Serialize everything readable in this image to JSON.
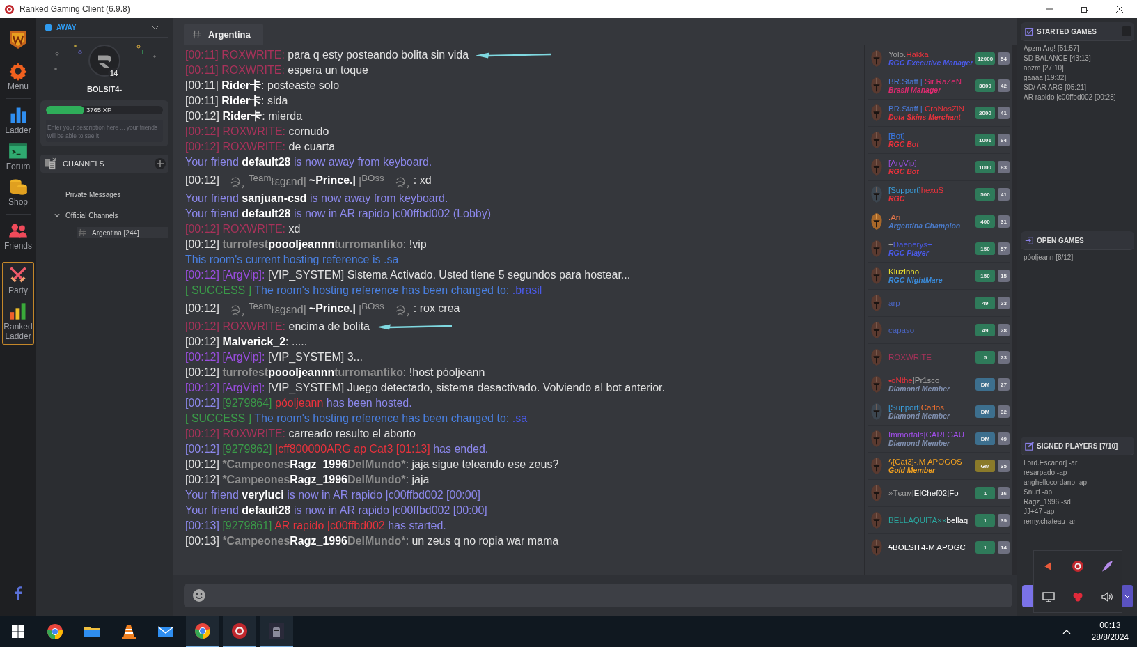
{
  "window": {
    "title": "Ranked Gaming Client (6.9.8)"
  },
  "nav": [
    {
      "label": "Menu",
      "selected": false
    },
    {
      "label": "Ladder",
      "selected": false
    },
    {
      "label": "Forum",
      "selected": false
    },
    {
      "label": "Shop",
      "selected": false
    },
    {
      "label": "Friends",
      "selected": false
    },
    {
      "label": "Party",
      "selected": true
    },
    {
      "label": "Ranked Ladder",
      "selected": true
    }
  ],
  "profile": {
    "status": "AWAY",
    "username": "BOLSIT4-",
    "level_badge": "14",
    "xp": "3765 XP",
    "level": 0.33,
    "description_placeholder": "Enter your description here ... your friends will be able to see it"
  },
  "channels": {
    "title": "CHANNELS",
    "items": [
      {
        "label": "Private Messages",
        "expanded": false
      },
      {
        "label": "Official Channels",
        "expanded": true,
        "children": [
          {
            "label": "Argentina [244]",
            "selected": true
          }
        ]
      }
    ]
  },
  "chat": {
    "tab": "Argentina",
    "lines": [
      {
        "marked": true,
        "segments": [
          {
            "kind": "plain",
            "text": "[00:11] ROXWRITE:",
            "color": "#a8325a"
          },
          {
            "kind": "plain",
            "text": " para q esty posteando bolita sin vida",
            "color": "#e2e2e2"
          }
        ]
      },
      {
        "marked": false,
        "segments": [
          {
            "kind": "plain",
            "text": "[00:11] ROXWRITE:",
            "color": "#a8325a"
          },
          {
            "kind": "plain",
            "text": " espera un toque",
            "color": "#e2e2e2"
          }
        ]
      },
      {
        "marked": false,
        "segments": [
          {
            "kind": "plain",
            "text": "[00:11] ",
            "color": "#e2e2e2"
          },
          {
            "kind": "bold",
            "text": "Rider卡",
            "color": "#ffffff"
          },
          {
            "kind": "plain",
            "text": ": posteaste solo",
            "color": "#e2e2e2"
          }
        ]
      },
      {
        "marked": false,
        "segments": [
          {
            "kind": "plain",
            "text": "[00:11] ",
            "color": "#e2e2e2"
          },
          {
            "kind": "bold",
            "text": "Rider卡",
            "color": "#ffffff"
          },
          {
            "kind": "plain",
            "text": ": sida",
            "color": "#e2e2e2"
          }
        ]
      },
      {
        "marked": false,
        "segments": [
          {
            "kind": "plain",
            "text": "[00:12] ",
            "color": "#e2e2e2"
          },
          {
            "kind": "bold",
            "text": "Rider卡",
            "color": "#ffffff"
          },
          {
            "kind": "plain",
            "text": ": mierda",
            "color": "#e2e2e2"
          }
        ]
      },
      {
        "marked": false,
        "segments": [
          {
            "kind": "plain",
            "text": "[00:12] ROXWRITE:",
            "color": "#a8325a"
          },
          {
            "kind": "plain",
            "text": " cornudo",
            "color": "#e2e2e2"
          }
        ]
      },
      {
        "marked": false,
        "segments": [
          {
            "kind": "plain",
            "text": "[00:12] ROXWRITE:",
            "color": "#a8325a"
          },
          {
            "kind": "plain",
            "text": " de cuarta",
            "color": "#e2e2e2"
          }
        ]
      },
      {
        "marked": false,
        "segments": [
          {
            "kind": "plain",
            "text": "Your friend ",
            "color": "#8c88ec"
          },
          {
            "kind": "bold",
            "text": "default28",
            "color": "#ffffff"
          },
          {
            "kind": "plain",
            "text": " is now away from keyboard.",
            "color": "#8c88ec"
          }
        ]
      },
      {
        "marked": false,
        "segments": [
          {
            "kind": "plain",
            "text": "[00:12]",
            "color": "#e2e2e2"
          },
          {
            "kind": "flourish"
          },
          {
            "kind": "plain",
            "text": "$^{Team}$ℓεgεnd|",
            "color": "#9a9a9a"
          },
          {
            "kind": "bold",
            "text": "~Prince.|",
            "color": "#ffffff"
          },
          {
            "kind": "plain",
            "text": "|$^{BOss}$",
            "color": "#9a9a9a"
          },
          {
            "kind": "flourish"
          },
          {
            "kind": "plain",
            "text": ": xd",
            "color": "#e2e2e2"
          }
        ]
      },
      {
        "marked": false,
        "segments": [
          {
            "kind": "plain",
            "text": "Your friend ",
            "color": "#8c88ec"
          },
          {
            "kind": "bold",
            "text": "sanjuan-csd",
            "color": "#ffffff"
          },
          {
            "kind": "plain",
            "text": " is now away from keyboard.",
            "color": "#8c88ec"
          }
        ]
      },
      {
        "marked": false,
        "segments": [
          {
            "kind": "plain",
            "text": "Your friend ",
            "color": "#8c88ec"
          },
          {
            "kind": "bold",
            "text": "default28",
            "color": "#ffffff"
          },
          {
            "kind": "plain",
            "text": " is now in AR rapido |c00ffbd002 (Lobby)",
            "color": "#8c88ec"
          }
        ]
      },
      {
        "marked": false,
        "segments": [
          {
            "kind": "plain",
            "text": "[00:12] ROXWRITE:",
            "color": "#a8325a"
          },
          {
            "kind": "plain",
            "text": " xd",
            "color": "#e2e2e2"
          }
        ]
      },
      {
        "marked": false,
        "segments": [
          {
            "kind": "plain",
            "text": "[00:12] ",
            "color": "#e2e2e2"
          },
          {
            "kind": "bold",
            "text": "turrofest",
            "color": "#8e8e8e"
          },
          {
            "kind": "bold",
            "text": "poooljeannn",
            "color": "#ffffff"
          },
          {
            "kind": "bold",
            "text": "turromantiko",
            "color": "#8e8e8e"
          },
          {
            "kind": "plain",
            "text": ": !vip",
            "color": "#e2e2e2"
          }
        ]
      },
      {
        "marked": false,
        "segments": [
          {
            "kind": "plain",
            "text": "This room's current hosting reference is .sa",
            "color": "#4a80e2"
          }
        ]
      },
      {
        "marked": false,
        "segments": [
          {
            "kind": "plain",
            "text": "[00:12] [ArgVip]:",
            "color": "#9a4ee0"
          },
          {
            "kind": "plain",
            "text": " [VIP_SYSTEM] Sistema Activado. Usted tiene 5 segundos para hostear...",
            "color": "#e2e2e2"
          }
        ]
      },
      {
        "marked": false,
        "segments": [
          {
            "kind": "plain",
            "text": "[ SUCCESS ]",
            "color": "#3a9a48"
          },
          {
            "kind": "plain",
            "text": " The room's hosting reference has been changed to: ",
            "color": "#4a80e2"
          },
          {
            "kind": "plain",
            "text": ".brasil",
            "color": "#4a5ae8"
          }
        ]
      },
      {
        "marked": false,
        "segments": [
          {
            "kind": "plain",
            "text": "[00:12]",
            "color": "#e2e2e2"
          },
          {
            "kind": "flourish"
          },
          {
            "kind": "plain",
            "text": "$^{Team}$ℓεgεnd|",
            "color": "#9a9a9a"
          },
          {
            "kind": "bold",
            "text": "~Prince.|",
            "color": "#ffffff"
          },
          {
            "kind": "plain",
            "text": "|$^{BOss}$",
            "color": "#9a9a9a"
          },
          {
            "kind": "flourish"
          },
          {
            "kind": "plain",
            "text": ": rox crea",
            "color": "#e2e2e2"
          }
        ]
      },
      {
        "marked": true,
        "segments": [
          {
            "kind": "plain",
            "text": "[00:12] ROXWRITE:",
            "color": "#a8325a"
          },
          {
            "kind": "plain",
            "text": " encima de bolita",
            "color": "#e2e2e2"
          }
        ]
      },
      {
        "marked": false,
        "segments": [
          {
            "kind": "plain",
            "text": "[00:12] ",
            "color": "#e2e2e2"
          },
          {
            "kind": "bold",
            "text": "Malverick_2",
            "color": "#ffffff"
          },
          {
            "kind": "plain",
            "text": ": .....",
            "color": "#e2e2e2"
          }
        ]
      },
      {
        "marked": false,
        "segments": [
          {
            "kind": "plain",
            "text": "[00:12] [ArgVip]:",
            "color": "#9a4ee0"
          },
          {
            "kind": "plain",
            "text": " [VIP_SYSTEM] 3...",
            "color": "#e2e2e2"
          }
        ]
      },
      {
        "marked": false,
        "segments": [
          {
            "kind": "plain",
            "text": "[00:12] ",
            "color": "#e2e2e2"
          },
          {
            "kind": "bold",
            "text": "turrofest",
            "color": "#8e8e8e"
          },
          {
            "kind": "bold",
            "text": "poooljeannn",
            "color": "#ffffff"
          },
          {
            "kind": "bold",
            "text": "turromantiko",
            "color": "#8e8e8e"
          },
          {
            "kind": "plain",
            "text": ": !host póoljeann",
            "color": "#e2e2e2"
          }
        ]
      },
      {
        "marked": false,
        "segments": [
          {
            "kind": "plain",
            "text": "[00:12] [ArgVip]:",
            "color": "#9a4ee0"
          },
          {
            "kind": "plain",
            "text": " [VIP_SYSTEM] Juego detectado, sistema desactivado. Volviendo al bot anterior.",
            "color": "#e2e2e2"
          }
        ]
      },
      {
        "marked": false,
        "segments": [
          {
            "kind": "plain",
            "text": "[00:12] ",
            "color": "#8c88ec"
          },
          {
            "kind": "plain",
            "text": "[9279864]",
            "color": "#3a9a48"
          },
          {
            "kind": "plain",
            "text": " póoljeann",
            "color": "#e8323c"
          },
          {
            "kind": "plain",
            "text": " has been hosted.",
            "color": "#8c88ec"
          }
        ]
      },
      {
        "marked": false,
        "segments": [
          {
            "kind": "plain",
            "text": "[ SUCCESS ]",
            "color": "#3a9a48"
          },
          {
            "kind": "plain",
            "text": " The room's hosting reference has been changed to: ",
            "color": "#4a80e2"
          },
          {
            "kind": "plain",
            "text": ".sa",
            "color": "#4a5ae8"
          }
        ]
      },
      {
        "marked": false,
        "segments": [
          {
            "kind": "plain",
            "text": "[00:12] ROXWRITE:",
            "color": "#a8325a"
          },
          {
            "kind": "plain",
            "text": " carreado resulto el aborto",
            "color": "#e2e2e2"
          }
        ]
      },
      {
        "marked": false,
        "segments": [
          {
            "kind": "plain",
            "text": "[00:12] ",
            "color": "#8c88ec"
          },
          {
            "kind": "plain",
            "text": "[9279862]",
            "color": "#3a9a48"
          },
          {
            "kind": "plain",
            "text": " |cff800000ARG ap Cat3 [01:13]",
            "color": "#e8323c"
          },
          {
            "kind": "plain",
            "text": " has ended.",
            "color": "#8c88ec"
          }
        ]
      },
      {
        "marked": false,
        "segments": [
          {
            "kind": "plain",
            "text": "[00:12] ",
            "color": "#e2e2e2"
          },
          {
            "kind": "bold",
            "text": "*Campeones",
            "color": "#8e8e8e"
          },
          {
            "kind": "bold",
            "text": "Ragz_1996",
            "color": "#ffffff"
          },
          {
            "kind": "bold",
            "text": "DelMundo*",
            "color": "#8e8e8e"
          },
          {
            "kind": "plain",
            "text": ": jaja sigue teleando ese zeus?",
            "color": "#e2e2e2"
          }
        ]
      },
      {
        "marked": false,
        "segments": [
          {
            "kind": "plain",
            "text": "[00:12] ",
            "color": "#e2e2e2"
          },
          {
            "kind": "bold",
            "text": "*Campeones",
            "color": "#8e8e8e"
          },
          {
            "kind": "bold",
            "text": "Ragz_1996",
            "color": "#ffffff"
          },
          {
            "kind": "bold",
            "text": "DelMundo*",
            "color": "#8e8e8e"
          },
          {
            "kind": "plain",
            "text": ": jaja",
            "color": "#e2e2e2"
          }
        ]
      },
      {
        "marked": false,
        "segments": [
          {
            "kind": "plain",
            "text": "Your friend ",
            "color": "#8c88ec"
          },
          {
            "kind": "bold",
            "text": "veryluci",
            "color": "#ffffff"
          },
          {
            "kind": "plain",
            "text": " is now in AR rapido |c00ffbd002 [00:00]",
            "color": "#8c88ec"
          }
        ]
      },
      {
        "marked": false,
        "segments": [
          {
            "kind": "plain",
            "text": "Your friend ",
            "color": "#8c88ec"
          },
          {
            "kind": "bold",
            "text": "default28",
            "color": "#ffffff"
          },
          {
            "kind": "plain",
            "text": " is now in AR rapido |c00ffbd002 [00:00]",
            "color": "#8c88ec"
          }
        ]
      },
      {
        "marked": false,
        "segments": [
          {
            "kind": "plain",
            "text": "[00:13] ",
            "color": "#8c88ec"
          },
          {
            "kind": "plain",
            "text": "[9279861]",
            "color": "#3a9a48"
          },
          {
            "kind": "plain",
            "text": " AR rapido |c00ffbd002",
            "color": "#e8323c"
          },
          {
            "kind": "plain",
            "text": " has started.",
            "color": "#8c88ec"
          }
        ]
      },
      {
        "marked": false,
        "segments": [
          {
            "kind": "plain",
            "text": "[00:13] ",
            "color": "#e2e2e2"
          },
          {
            "kind": "bold",
            "text": "*Campeones",
            "color": "#8e8e8e"
          },
          {
            "kind": "bold",
            "text": "Ragz_1996",
            "color": "#ffffff"
          },
          {
            "kind": "bold",
            "text": "DelMundo*",
            "color": "#8e8e8e"
          },
          {
            "kind": "plain",
            "text": ": un zeus q no ropia war mama",
            "color": "#e2e2e2"
          }
        ]
      }
    ]
  },
  "users": [
    {
      "kind": "bronze",
      "name": [
        {
          "text": "Yolo.",
          "color": "#a0a0a0"
        },
        {
          "text": "Hakka",
          "color": "#e8323c"
        }
      ],
      "title": {
        "text": "RGC Executive Manager",
        "color": "#4a5ae8"
      },
      "points": {
        "text": "12000",
        "color": "#2f7a5a"
      },
      "user_level": "54"
    },
    {
      "kind": "bronze",
      "name": [
        {
          "text": "BR.Staff | ",
          "color": "#4a7ad8"
        },
        {
          "text": "Sir.RaZeN",
          "color": "#e02a70"
        }
      ],
      "title": {
        "text": "Brasil Manager",
        "color": "#e02a70"
      },
      "points": {
        "text": "3000",
        "color": "#2f7a5a"
      },
      "user_level": "42"
    },
    {
      "kind": "bronze",
      "name": [
        {
          "text": "BR.Staff | ",
          "color": "#4a7ad8"
        },
        {
          "text": "CroNosZiN",
          "color": "#e8323c"
        }
      ],
      "title": {
        "text": "Dota Skins Merchant",
        "color": "#e8323c"
      },
      "points": {
        "text": "2000",
        "color": "#2f7a5a"
      },
      "user_level": "41"
    },
    {
      "kind": "bronze",
      "name": [
        {
          "text": "[Bot]",
          "color": "#3a7ae8"
        }
      ],
      "title": {
        "text": "RGC Bot",
        "color": "#e8323c"
      },
      "points": {
        "text": "1001",
        "color": "#2f7a5a"
      },
      "user_level": "64"
    },
    {
      "kind": "bronze",
      "name": [
        {
          "text": "[ArgVip]",
          "color": "#9a4ee0"
        }
      ],
      "title": {
        "text": "RGC Bot",
        "color": "#e8323c"
      },
      "points": {
        "text": "1000",
        "color": "#2f7a5a"
      },
      "user_level": "63"
    },
    {
      "kind": "steel",
      "name": [
        {
          "text": "[Support]",
          "color": "#3aa0e0"
        },
        {
          "text": "hexuS",
          "color": "#e8323c"
        }
      ],
      "title": {
        "text": "RGC",
        "color": "#e8323c"
      },
      "points": {
        "text": "500",
        "color": "#2f7a5a"
      },
      "user_level": "41"
    },
    {
      "kind": "gold",
      "name": [
        {
          "text": ".Ari",
          "color": "#f07a4a"
        }
      ],
      "title": {
        "text": "Argentina Champion",
        "color": "#4a7ac8"
      },
      "points": {
        "text": "400",
        "color": "#2f7a5a"
      },
      "user_level": "31"
    },
    {
      "kind": "bronze",
      "name": [
        {
          "text": "+",
          "color": "#a0a0a0"
        },
        {
          "text": "Daenerys",
          "color": "#4a5ae8"
        },
        {
          "text": "+",
          "color": "#4a5ae8"
        }
      ],
      "title": {
        "text": "RGC Player",
        "color": "#4a5ae8"
      },
      "points": {
        "text": "150",
        "color": "#2f7a5a"
      },
      "user_level": "57"
    },
    {
      "kind": "bronze",
      "name": [
        {
          "text": "Kluzinho",
          "color": "#e8e030"
        }
      ],
      "title": {
        "text": "RGC NightMare",
        "color": "#3a8ad8"
      },
      "points": {
        "text": "150",
        "color": "#2f7a5a"
      },
      "user_level": "15"
    },
    {
      "kind": "bronze",
      "name": [
        {
          "text": "arp",
          "color": "#4a64c0"
        }
      ],
      "points": {
        "text": "49",
        "color": "#2f7a5a"
      },
      "user_level": "23"
    },
    {
      "kind": "bronze",
      "name": [
        {
          "text": "capaso",
          "color": "#4a64c0"
        }
      ],
      "points": {
        "text": "49",
        "color": "#2f7a5a"
      },
      "user_level": "28"
    },
    {
      "kind": "bronze",
      "name": [
        {
          "text": "ROXWRITE",
          "color": "#a8325a"
        }
      ],
      "points": {
        "text": "5",
        "color": "#2f7a5a"
      },
      "user_level": "23"
    },
    {
      "kind": "bronze",
      "name": [
        {
          "text": "•oNthe",
          "color": "#e8323c"
        },
        {
          "text": "|Pr1sco",
          "color": "#a8a8a8"
        }
      ],
      "title": {
        "text": "Diamond Member",
        "color": "#8090b0"
      },
      "points": {
        "text": "DM",
        "color": "#3d6f8e"
      },
      "user_level": "27"
    },
    {
      "kind": "steel",
      "name": [
        {
          "text": "[Support]",
          "color": "#3aa0e0"
        },
        {
          "text": "Carlos",
          "color": "#f07030"
        }
      ],
      "title": {
        "text": "Diamond Member",
        "color": "#8090b0"
      },
      "points": {
        "text": "DM",
        "color": "#3d6f8e"
      },
      "user_level": "32"
    },
    {
      "kind": "bronze",
      "name": [
        {
          "text": "Immortals|CARLGAU",
          "color": "#a04ee8"
        }
      ],
      "title": {
        "text": "Diamond Member",
        "color": "#8090b0"
      },
      "points": {
        "text": "DM",
        "color": "#3d6f8e"
      },
      "user_level": "49"
    },
    {
      "kind": "bronze",
      "name": [
        {
          "text": "ϟ[Cat3]-.M APOGOS",
          "color": "#f0a020"
        }
      ],
      "title": {
        "text": "Gold Member",
        "color": "#f0a020"
      },
      "points": {
        "text": "GM",
        "color": "#8a7a2a"
      },
      "user_level": "35"
    },
    {
      "kind": "bronze",
      "name": [
        {
          "text": "»Tєαм|",
          "color": "#a0a0a0"
        },
        {
          "text": "ElChef02|Fo",
          "color": "#ffffff"
        }
      ],
      "points": {
        "text": "1",
        "color": "#2f7a5a"
      },
      "user_level": "16"
    },
    {
      "kind": "bronze",
      "name": [
        {
          "text": "BELLAQUITA××",
          "color": "#2aa8a0"
        },
        {
          "text": "bellaq",
          "color": "#ffffff"
        }
      ],
      "points": {
        "text": "1",
        "color": "#2f7a5a"
      },
      "user_level": "39"
    },
    {
      "kind": "bronze",
      "name": [
        {
          "text": "ϟBOLSIT4-M APOGC",
          "color": "#ffffff"
        }
      ],
      "points": {
        "text": "1",
        "color": "#2f7a5a"
      },
      "user_level": "14"
    }
  ],
  "started_games": {
    "title": "STARTED GAMES",
    "items": [
      "Apzm Arg! [51:57]",
      "SD BALANCE [43:13]",
      "apzm [27:10]",
      "gaaaa [19:32]",
      "SD/ AR ARG [05:21]",
      "AR rapido |c00ffbd002 [00:28]"
    ]
  },
  "open_games": {
    "title": "OPEN GAMES",
    "items": [
      "póoljeann [8/12]"
    ]
  },
  "signed_players": {
    "title": "SIGNED PLAYERS [7/10]",
    "items": [
      "Lord.Escanor] -ar",
      "resarpado -ap",
      "anghellocordano -ap",
      "Snurf -ap",
      "Ragz_1996 -sd",
      "JJ+47 -ap",
      "remy.chateau -ar"
    ]
  },
  "taskbar": {
    "apps": [
      {
        "selected": false
      },
      {
        "selected": false
      },
      {
        "selected": false
      },
      {
        "selected": false
      },
      {
        "selected": true
      },
      {
        "selected": true
      },
      {
        "selected": true
      }
    ],
    "time": "00:13",
    "date": "28/8/2024"
  }
}
